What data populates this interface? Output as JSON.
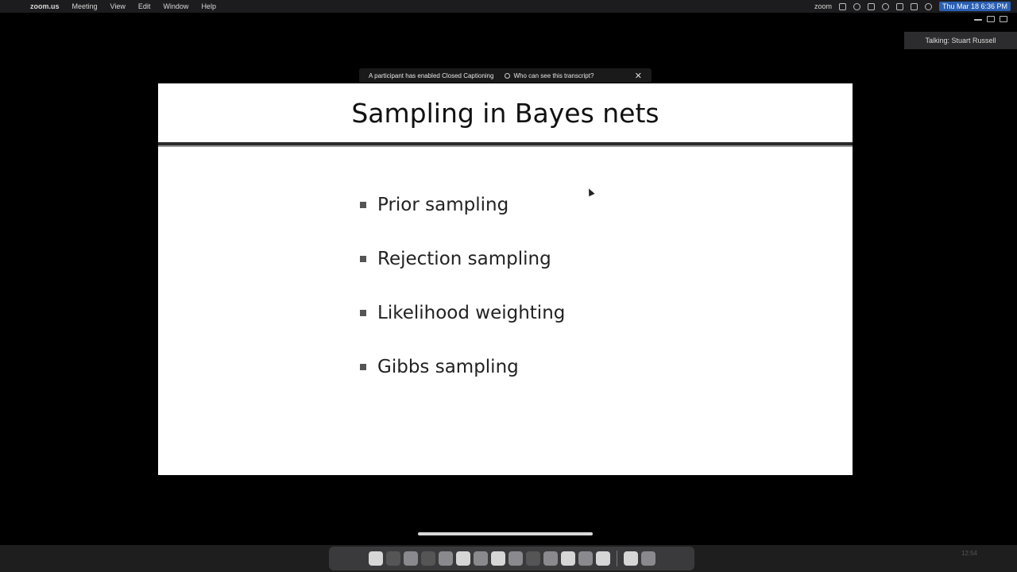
{
  "menubar": {
    "app_name": "zoom.us",
    "items": [
      "Meeting",
      "View",
      "Edit",
      "Window",
      "Help"
    ],
    "right_label": "zoom",
    "clock": "Thu Mar 18  6:36 PM"
  },
  "talking_indicator": "Talking: Stuart Russell",
  "caption_banner": {
    "message": "A participant has enabled Closed Captioning",
    "link": "Who can see this transcript?",
    "close": "✕"
  },
  "slide": {
    "title": "Sampling in Bayes nets",
    "bullets": [
      "Prior sampling",
      "Rejection sampling",
      "Likelihood weighting",
      "Gibbs sampling"
    ]
  },
  "dock_bar": {
    "right_text": "12:54"
  }
}
